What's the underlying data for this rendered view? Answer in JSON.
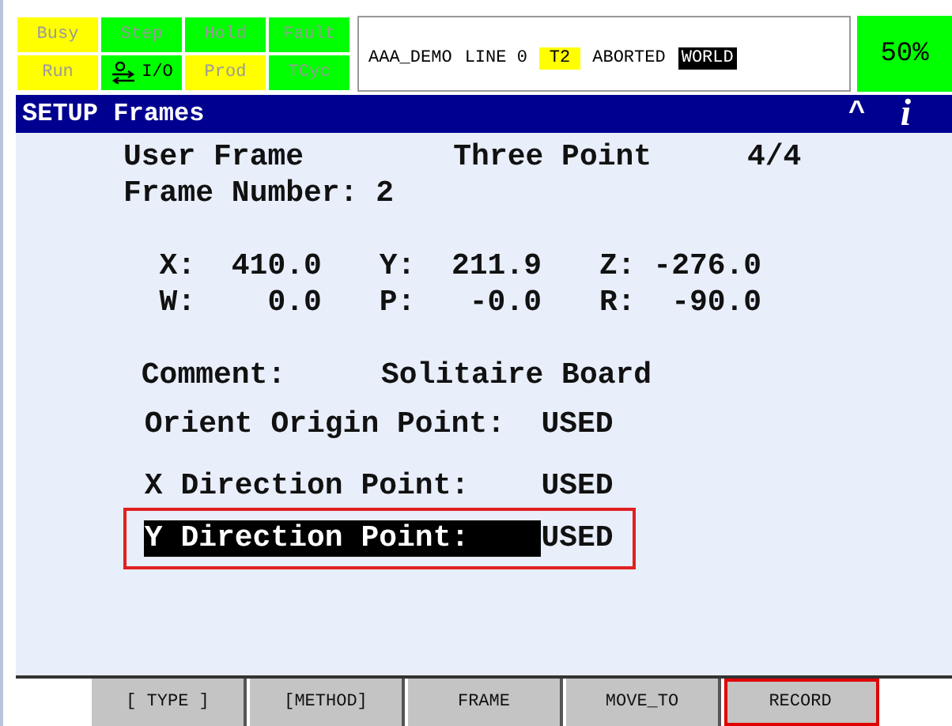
{
  "status_lamps": [
    {
      "label": "Busy",
      "color": "#ffff00",
      "on": false
    },
    {
      "label": "Step",
      "color": "#00ff00",
      "on": false
    },
    {
      "label": "Hold",
      "color": "#00ff00",
      "on": false
    },
    {
      "label": "Fault",
      "color": "#00ff00",
      "on": false
    },
    {
      "label": "Run",
      "color": "#ffff00",
      "on": false
    },
    {
      "kind": "io",
      "label": "I/O",
      "color": "#00ff00",
      "on": true
    },
    {
      "label": "Prod",
      "color": "#ffff00",
      "on": false
    },
    {
      "label": "TCyc",
      "color": "#00ff00",
      "on": false
    }
  ],
  "status_line": {
    "program": "AAA_DEMO",
    "line": "LINE 0",
    "mode": "T2",
    "state": "ABORTED",
    "frame": "WORLD"
  },
  "override": "50%",
  "title_bar": {
    "title": "SETUP Frames",
    "up_key": "^",
    "info_key": "i"
  },
  "header": {
    "frame_type": "User Frame",
    "method": "Three Point",
    "page": "4/4",
    "frame_number": "Frame Number: 2"
  },
  "position": [
    [
      {
        "axis": "X:",
        "value": "410.0"
      },
      {
        "axis": "Y:",
        "value": "211.9"
      },
      {
        "axis": "Z:",
        "value": "-276.0"
      }
    ],
    [
      {
        "axis": "W:",
        "value": "0.0"
      },
      {
        "axis": "P:",
        "value": "-0.0"
      },
      {
        "axis": "R:",
        "value": "-90.0"
      }
    ]
  ],
  "comment": {
    "label": "Comment:",
    "value": "Solitaire Board"
  },
  "points": [
    {
      "label": "Orient Origin Point:",
      "value": "USED",
      "selected": false,
      "highlighted": false
    },
    {
      "label": "X Direction Point:",
      "value": "USED",
      "selected": false,
      "highlighted": false
    },
    {
      "label": "Y Direction Point:",
      "value": "USED",
      "selected": true,
      "highlighted": true
    }
  ],
  "function_keys": [
    {
      "label": "[ TYPE ]",
      "highlighted": false
    },
    {
      "label": "[METHOD]",
      "highlighted": false
    },
    {
      "label": "FRAME",
      "highlighted": false
    },
    {
      "label": "MOVE_TO",
      "highlighted": false
    },
    {
      "label": "RECORD",
      "highlighted": true
    }
  ]
}
